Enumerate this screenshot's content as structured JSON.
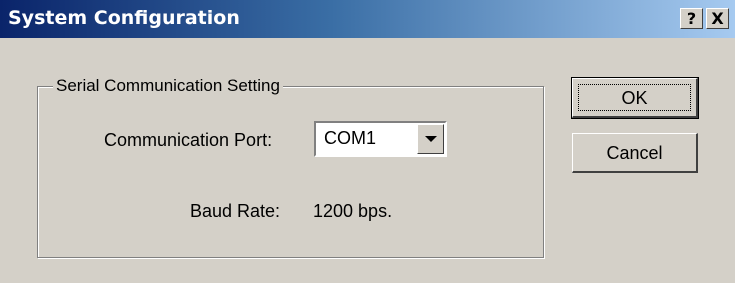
{
  "window": {
    "title": "System Configuration",
    "help_label": "?",
    "close_label": "X"
  },
  "group": {
    "title": "Serial Communication Setting",
    "port_label": "Communication Port:",
    "port_value": "COM1",
    "baud_label": "Baud Rate:",
    "baud_value": "1200 bps."
  },
  "buttons": {
    "ok_label": "OK",
    "cancel_label": "Cancel"
  },
  "colors": {
    "titlebar_start": "#0a246a",
    "titlebar_end": "#a6caf0",
    "face": "#d4d0c8"
  }
}
